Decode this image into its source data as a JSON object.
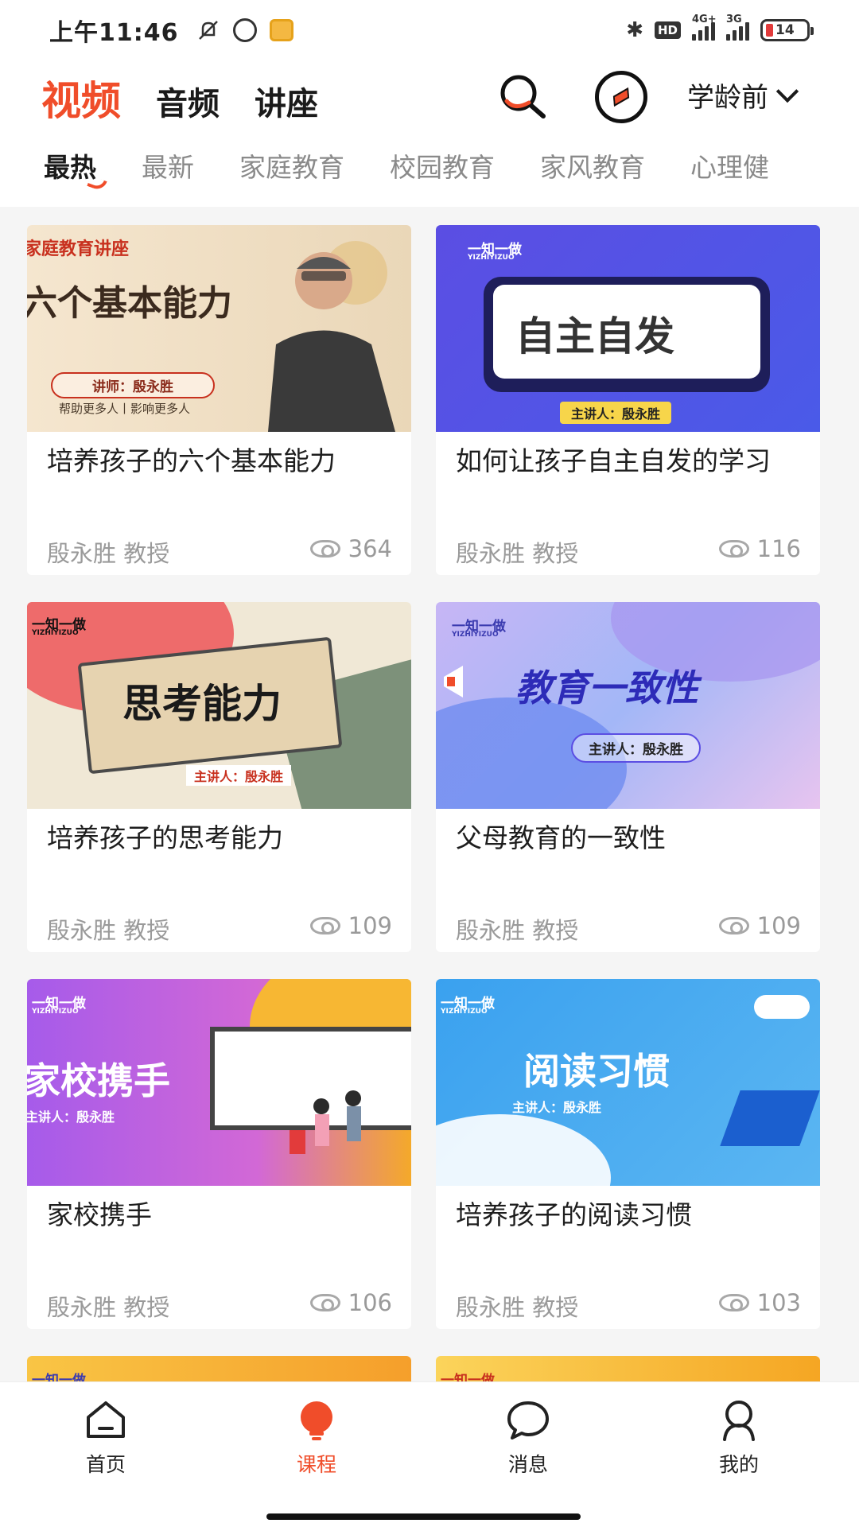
{
  "status_bar": {
    "time": "上午11:46",
    "network_1": "4G+",
    "network_2": "3G",
    "battery": "14",
    "hd": "HD"
  },
  "header": {
    "tabs": [
      {
        "label": "视频",
        "active": true
      },
      {
        "label": "音频",
        "active": false
      },
      {
        "label": "讲座",
        "active": false
      }
    ],
    "age_filter": "学龄前"
  },
  "categories": [
    {
      "label": "最热",
      "active": true
    },
    {
      "label": "最新",
      "active": false
    },
    {
      "label": "家庭教育",
      "active": false
    },
    {
      "label": "校园教育",
      "active": false
    },
    {
      "label": "家风教育",
      "active": false
    },
    {
      "label": "心理健",
      "active": false
    }
  ],
  "cards": [
    {
      "title": "培养孩子的六个基本能力",
      "author": "殷永胜 教授",
      "views": "364",
      "thumb": {
        "series": "家庭教育讲座",
        "headline": "六个基本能力",
        "lecturer": "讲师：殷永胜",
        "tagline": "帮助更多人丨影响更多人"
      }
    },
    {
      "title": "如何让孩子自主自发的学习",
      "author": "殷永胜 教授",
      "views": "116",
      "thumb": {
        "brand": "一知一做",
        "brand_en": "YIZHIYIZUO",
        "headline": "自主自发",
        "lecturer": "主讲人：殷永胜"
      }
    },
    {
      "title": "培养孩子的思考能力",
      "author": "殷永胜 教授",
      "views": "109",
      "thumb": {
        "brand": "一知一做",
        "brand_en": "YIZHIYIZUO",
        "headline": "思考能力",
        "lecturer": "主讲人：殷永胜"
      }
    },
    {
      "title": "父母教育的一致性",
      "author": "殷永胜 教授",
      "views": "109",
      "thumb": {
        "brand": "一知一做",
        "brand_en": "YIZHIYIZUO",
        "headline": "教育一致性",
        "lecturer": "主讲人：殷永胜"
      }
    },
    {
      "title": "家校携手",
      "author": "殷永胜 教授",
      "views": "106",
      "thumb": {
        "brand": "一知一做",
        "brand_en": "YIZHIYIZUO",
        "headline": "家校携手",
        "lecturer": "主讲人：殷永胜"
      }
    },
    {
      "title": "培养孩子的阅读习惯",
      "author": "殷永胜 教授",
      "views": "103",
      "thumb": {
        "brand": "一知一做",
        "brand_en": "YIZHIYIZUO",
        "headline": "阅读习惯",
        "lecturer": "主讲人：殷永胜"
      }
    },
    {
      "thumb": {
        "brand": "一知一做"
      }
    },
    {
      "thumb": {
        "brand": "一知一做"
      }
    }
  ],
  "bottom_nav": [
    {
      "label": "首页",
      "icon": "home-icon",
      "active": false
    },
    {
      "label": "课程",
      "icon": "lightbulb-icon",
      "active": true
    },
    {
      "label": "消息",
      "icon": "chat-bubble-icon",
      "active": false
    },
    {
      "label": "我的",
      "icon": "user-icon",
      "active": false
    }
  ],
  "colors": {
    "accent": "#f04d2a",
    "text_primary": "#1e1e1e",
    "text_secondary": "#9a9a9a"
  }
}
